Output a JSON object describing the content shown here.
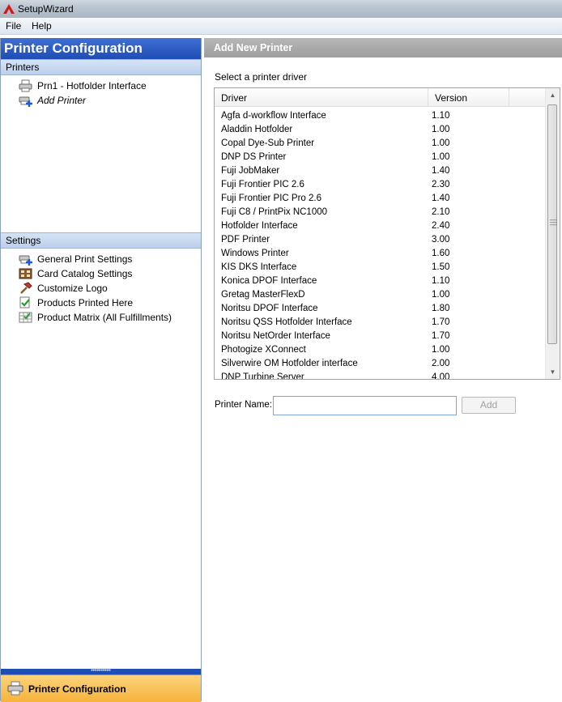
{
  "window": {
    "title": "SetupWizard"
  },
  "menu": {
    "items": [
      "File",
      "Help"
    ]
  },
  "left": {
    "header": "Printer Configuration",
    "printers_section": "Printers",
    "printers": [
      {
        "label": "Prn1 - Hotfolder Interface",
        "icon": "printer-icon"
      },
      {
        "label": "Add Printer",
        "icon": "add-printer-icon"
      }
    ],
    "settings_section": "Settings",
    "settings": [
      {
        "label": "General Print Settings",
        "icon": "print-settings-icon"
      },
      {
        "label": "Card Catalog Settings",
        "icon": "card-catalog-icon"
      },
      {
        "label": "Customize Logo",
        "icon": "hammer-icon"
      },
      {
        "label": "Products Printed Here",
        "icon": "products-icon"
      },
      {
        "label": "Product Matrix (All Fulfillments)",
        "icon": "matrix-icon"
      }
    ],
    "bottom_bar": "Printer Configuration"
  },
  "right": {
    "header": "Add New Printer",
    "instruction": "Select a printer driver",
    "columns": [
      "Driver",
      "Version"
    ],
    "drivers": [
      [
        "Agfa d-workflow Interface",
        "1.10"
      ],
      [
        "Aladdin Hotfolder",
        "1.00"
      ],
      [
        "Copal Dye-Sub Printer",
        "1.00"
      ],
      [
        "DNP DS Printer",
        "1.00"
      ],
      [
        "Fuji JobMaker",
        "1.40"
      ],
      [
        "Fuji Frontier PIC 2.6",
        "2.30"
      ],
      [
        "Fuji Frontier PIC Pro 2.6",
        "1.40"
      ],
      [
        "Fuji C8 / PrintPix NC1000",
        "2.10"
      ],
      [
        "Hotfolder Interface",
        "2.40"
      ],
      [
        "PDF Printer",
        "3.00"
      ],
      [
        "Windows Printer",
        "1.60"
      ],
      [
        "KIS DKS Interface",
        "1.50"
      ],
      [
        "Konica DPOF Interface",
        "1.10"
      ],
      [
        "Gretag MasterFlexD",
        "1.00"
      ],
      [
        "Noritsu DPOF Interface",
        "1.80"
      ],
      [
        "Noritsu QSS Hotfolder Interface",
        "1.70"
      ],
      [
        "Noritsu NetOrder Interface",
        "1.70"
      ],
      [
        "Photogize XConnect",
        "1.00"
      ],
      [
        "Silverwire OM Hotfolder interface",
        "2.00"
      ],
      [
        "DNP Turbine Server",
        "4.00"
      ]
    ],
    "printer_name_label": "Printer Name:",
    "printer_name_value": "",
    "add_button": "Add"
  }
}
